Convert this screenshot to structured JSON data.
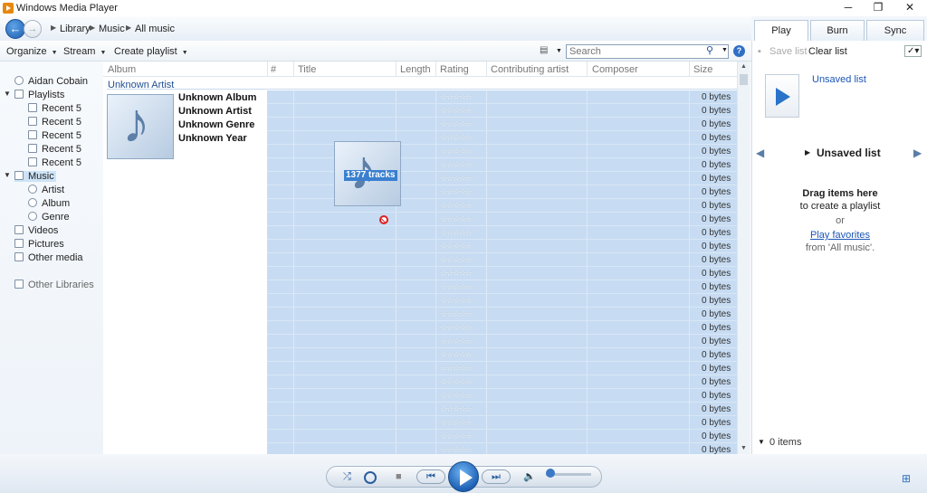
{
  "window": {
    "title": "Windows Media Player",
    "minimize": "─",
    "restore": "❐",
    "close": "✕"
  },
  "breadcrumb": [
    "Library",
    "Music",
    "All music"
  ],
  "tabs": [
    "Play",
    "Burn",
    "Sync"
  ],
  "toolbar": {
    "organize": "Organize",
    "stream": "Stream",
    "create_playlist": "Create playlist",
    "search_placeholder": "Search"
  },
  "right_toolbar": {
    "save_list": "Save list",
    "clear_list": "Clear list"
  },
  "nav": {
    "user": "Aidan Cobain",
    "playlists": "Playlists",
    "recent": [
      "Recent 5",
      "Recent 5",
      "Recent 5",
      "Recent 5",
      "Recent 5"
    ],
    "music": "Music",
    "artist": "Artist",
    "album": "Album",
    "genre": "Genre",
    "videos": "Videos",
    "pictures": "Pictures",
    "other_media": "Other media",
    "other_libraries": "Other Libraries"
  },
  "columns": [
    "Album",
    "#",
    "Title",
    "Length",
    "Rating",
    "Contributing artist",
    "Composer",
    "Size"
  ],
  "group": {
    "header": "Unknown Artist",
    "album": "Unknown Album",
    "artist": "Unknown Artist",
    "genre": "Unknown Genre",
    "year": "Unknown Year"
  },
  "row_size": "0 bytes",
  "rating_stars": "☆☆☆☆☆",
  "drag": {
    "label": "1377 tracks"
  },
  "list_pane": {
    "unsaved_top": "Unsaved list",
    "title": "Unsaved list",
    "drag_here": "Drag items here",
    "create_playlist": "to create a playlist",
    "or": "or",
    "play_favorites": "Play favorites",
    "from": "from 'All music'.",
    "items": "0 items"
  }
}
